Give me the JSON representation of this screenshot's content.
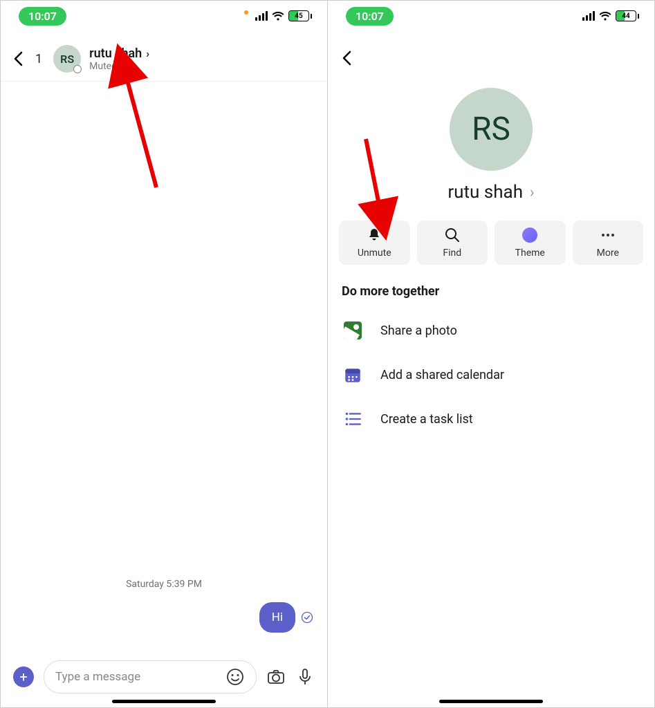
{
  "left": {
    "status": {
      "time": "10:07",
      "battery": "45"
    },
    "header": {
      "unread": "1",
      "initials": "RS",
      "name": "rutu shah",
      "subtitle": "Muted"
    },
    "chat": {
      "timestamp": "Saturday 5:39 PM",
      "message": "Hi"
    },
    "composer": {
      "placeholder": "Type a message"
    }
  },
  "right": {
    "status": {
      "time": "10:07",
      "battery": "44"
    },
    "profile": {
      "initials": "RS",
      "name": "rutu shah"
    },
    "actions": {
      "unmute": "Unmute",
      "find": "Find",
      "theme": "Theme",
      "more": "More"
    },
    "section_title": "Do more together",
    "options": {
      "photo": "Share a photo",
      "calendar": "Add a shared calendar",
      "tasks": "Create a task list"
    }
  }
}
